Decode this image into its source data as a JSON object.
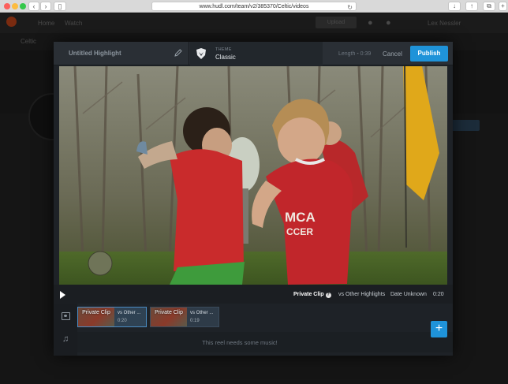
{
  "browser": {
    "url": "www.hudl.com/team/v2/385370/Celtic/videos"
  },
  "background_app": {
    "nav_items": [
      "Home",
      "Watch"
    ],
    "upload_label": "Upload",
    "user_label": "Lex Nessler",
    "team_label": "Celtic"
  },
  "editor": {
    "title": "Untitled Highlight",
    "theme_label": "THEME",
    "theme_value": "Classic",
    "length_label": "Length",
    "length_value": "0:39",
    "cancel_label": "Cancel",
    "publish_label": "Publish"
  },
  "player": {
    "clip_type": "Private Clip",
    "opponent": "vs Other Highlights",
    "date": "Date Unknown",
    "duration": "0:20"
  },
  "timeline": {
    "clips": [
      {
        "thumb_label": "Private Clip",
        "name": "vs Other ...",
        "duration": "0:20",
        "selected": true
      },
      {
        "thumb_label": "Private Clip",
        "name": "vs Other ...",
        "duration": "0:19",
        "selected": false
      }
    ],
    "music_placeholder": "This reel needs some music!",
    "add_label": "+"
  },
  "colors": {
    "accent": "#1f93d9",
    "modal_bg": "#1e2227"
  },
  "icons": [
    "film-icon",
    "music-note-icon",
    "pencil-icon",
    "shield-icon",
    "play-icon",
    "help-icon"
  ]
}
